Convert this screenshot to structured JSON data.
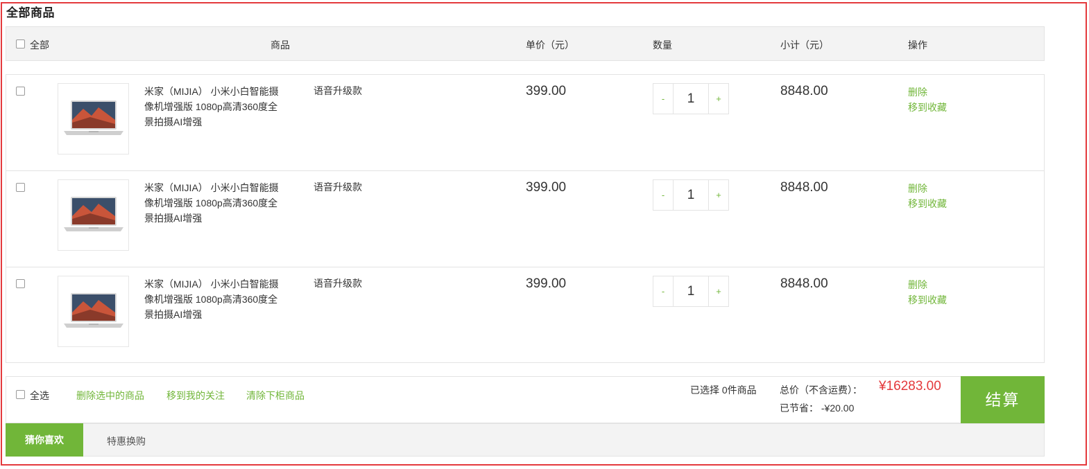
{
  "cart": {
    "title": "全部商品"
  },
  "header": {
    "all": "全部",
    "product": "商品",
    "unit_price": "单价（元）",
    "quantity": "数量",
    "subtotal": "小计（元）",
    "actions": "操作"
  },
  "items": [
    {
      "name": "米家（MIJIA） 小米小白智能摄像机增强版 1080p高清360度全景拍摄AI增强",
      "spec": "语音升级款",
      "price": "399.00",
      "quantity": "1",
      "subtotal": "8848.00",
      "delete": "删除",
      "favorite": "移到收藏",
      "minus": "-",
      "plus": "+"
    },
    {
      "name": "米家（MIJIA） 小米小白智能摄像机增强版 1080p高清360度全景拍摄AI增强",
      "spec": "语音升级款",
      "price": "399.00",
      "quantity": "1",
      "subtotal": "8848.00",
      "delete": "删除",
      "favorite": "移到收藏",
      "minus": "-",
      "plus": "+"
    },
    {
      "name": "米家（MIJIA） 小米小白智能摄像机增强版 1080p高清360度全景拍摄AI增强",
      "spec": "语音升级款",
      "price": "399.00",
      "quantity": "1",
      "subtotal": "8848.00",
      "delete": "删除",
      "favorite": "移到收藏",
      "minus": "-",
      "plus": "+"
    }
  ],
  "footer": {
    "select_all": "全选",
    "delete_selected": "删除选中的商品",
    "move_to_follow": "移到我的关注",
    "clear_unavailable": "清除下柜商品",
    "selected_count": "已选择 0件商品",
    "total_label": "总价（不含运费）：",
    "total": "¥16283.00",
    "saved": "已节省：  -¥20.00",
    "checkout": "结算"
  },
  "tabs": {
    "active": "猜你喜欢",
    "other": "特惠换购"
  },
  "colors": {
    "accent_green": "#71b639",
    "price_red": "#e4393c",
    "frame_red": "#e4393c"
  }
}
